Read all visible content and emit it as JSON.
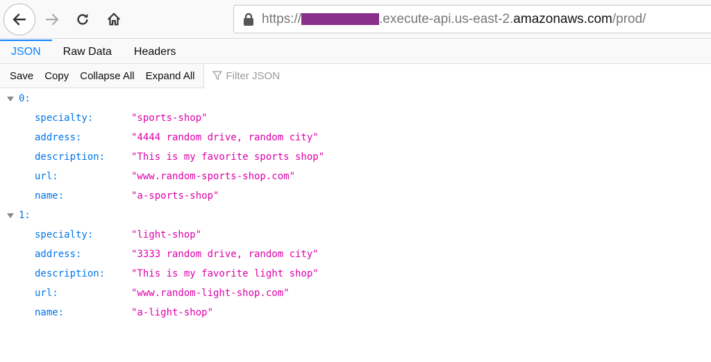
{
  "nav": {
    "url_prefix": "https://",
    "url_mid": ".execute-api.us-east-2.",
    "url_host": "amazonaws.com",
    "url_path": "/prod/"
  },
  "tabs": [
    {
      "label": "JSON"
    },
    {
      "label": "Raw Data"
    },
    {
      "label": "Headers"
    }
  ],
  "toolbar": {
    "save": "Save",
    "copy": "Copy",
    "collapse": "Collapse All",
    "expand": "Expand All",
    "filter_placeholder": "Filter JSON"
  },
  "items": [
    {
      "index": "0:",
      "fields": [
        {
          "k": "specialty:",
          "v": "\"sports-shop\""
        },
        {
          "k": "address:",
          "v": "\"4444 random drive, random city\""
        },
        {
          "k": "description:",
          "v": "\"This is my favorite sports shop\""
        },
        {
          "k": "url:",
          "v": "\"www.random-sports-shop.com\""
        },
        {
          "k": "name:",
          "v": "\"a-sports-shop\""
        }
      ]
    },
    {
      "index": "1:",
      "fields": [
        {
          "k": "specialty:",
          "v": "\"light-shop\""
        },
        {
          "k": "address:",
          "v": "\"3333 random drive, random city\""
        },
        {
          "k": "description:",
          "v": "\"This is my favorite light shop\""
        },
        {
          "k": "url:",
          "v": "\"www.random-light-shop.com\""
        },
        {
          "k": "name:",
          "v": "\"a-light-shop\""
        }
      ]
    }
  ]
}
